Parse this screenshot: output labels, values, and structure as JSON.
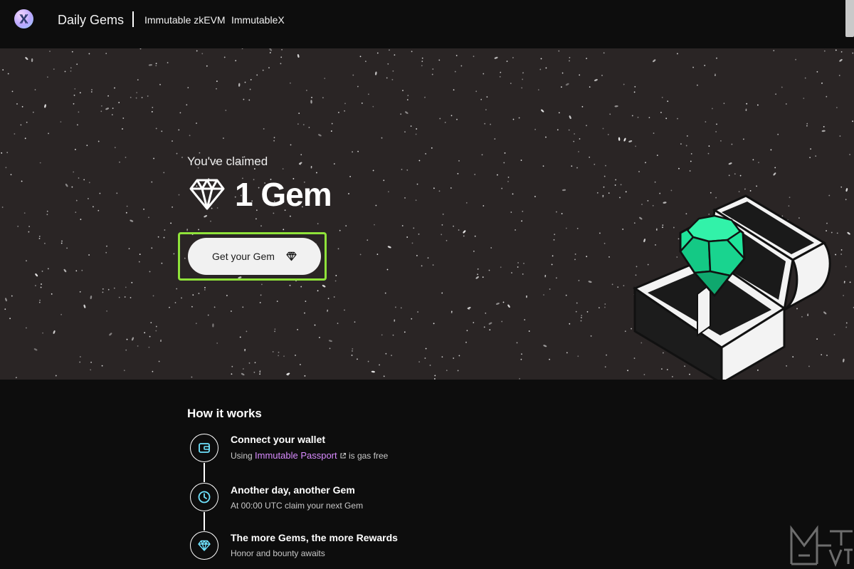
{
  "header": {
    "brand": "Daily Gems",
    "nav": [
      "Immutable zkEVM",
      "ImmutableX"
    ]
  },
  "hero": {
    "claimed_label": "You've claimed",
    "gem_count": "1 Gem",
    "cta_label": "Get your Gem"
  },
  "how_it_works": {
    "title": "How it works",
    "steps": [
      {
        "title": "Connect your wallet",
        "desc_prefix": "Using ",
        "link_text": "Immutable Passport",
        "desc_suffix": " is gas free",
        "icon": "wallet-icon"
      },
      {
        "title": "Another day, another Gem",
        "desc": "At 00:00 UTC claim your next Gem",
        "icon": "clock-icon"
      },
      {
        "title": "The more Gems, the more Rewards",
        "desc": "Honor and bounty awaits",
        "icon": "gem-icon"
      }
    ]
  },
  "colors": {
    "header_bg": "#0d0d0d",
    "hero_bg": "#2a2525",
    "accent_link": "#d98bff",
    "highlight": "#8fe23a",
    "gem_green": "#1fe39a",
    "step_icon": "#6fe3ff"
  }
}
